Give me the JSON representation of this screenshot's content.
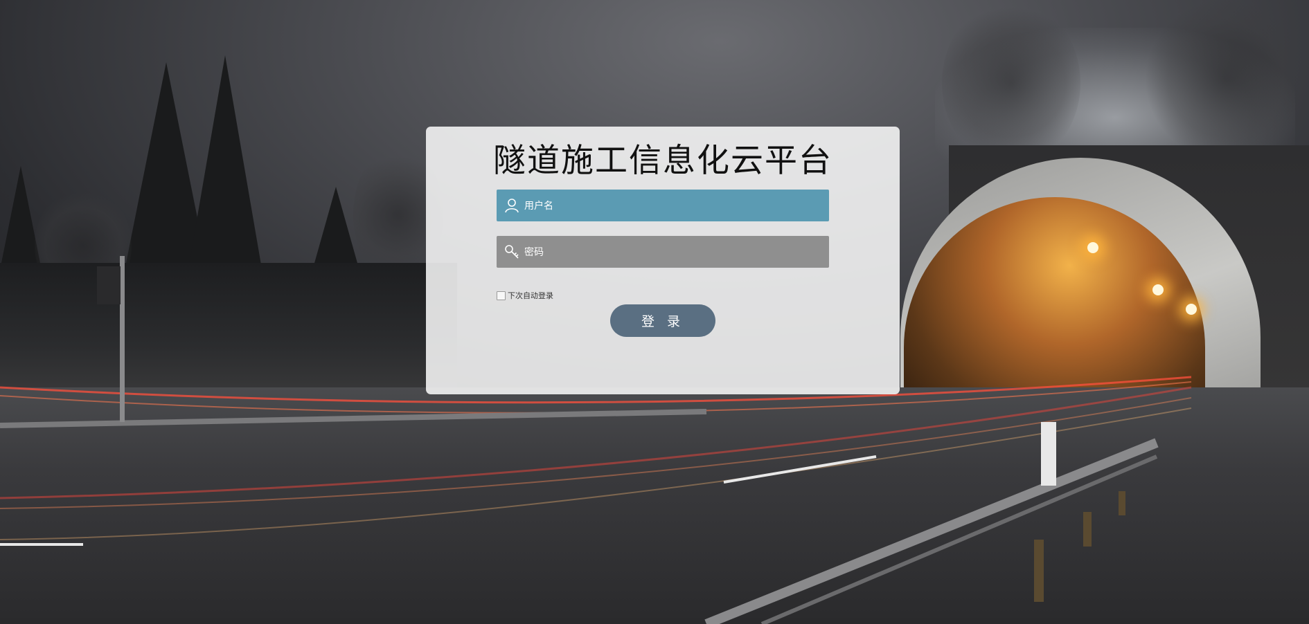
{
  "page": {
    "title": "隧道施工信息化云平台"
  },
  "login": {
    "username_placeholder": "用户名",
    "password_placeholder": "密码",
    "username_icon": "user-icon",
    "password_icon": "key-icon",
    "remember_label": "下次自动登录",
    "remember_checked": false,
    "submit_label": "登 录"
  },
  "colors": {
    "username_field_bg": "#5b9bb3",
    "password_field_bg": "#8f8f8f",
    "button_bg": "#5a6f82",
    "panel_bg": "rgba(255,255,255,0.84)"
  }
}
